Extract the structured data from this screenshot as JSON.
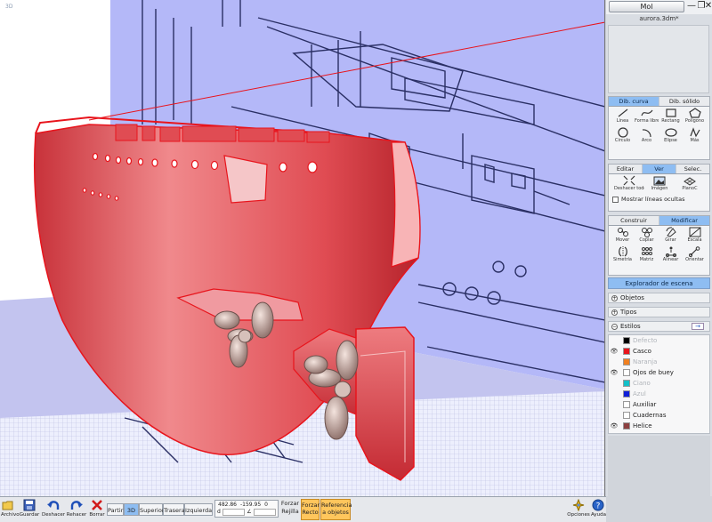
{
  "window": {
    "viewport_label": "3D",
    "mol_button": "Mol",
    "filename": "aurora.3dm*",
    "minimize": "—",
    "restore": "❐",
    "close": "✕"
  },
  "panels": {
    "curve_tabs": [
      "Dib. curva",
      "Dib. sólido"
    ],
    "curve_tools": [
      "Línea",
      "Forma libre",
      "Rectang",
      "Polígono",
      "Círculo",
      "Arco",
      "Elipse",
      "Más"
    ],
    "view_tabs": [
      "Editar",
      "Ver",
      "Selec."
    ],
    "view_tools": [
      "Deshacer todo",
      "Imágen",
      "PlanoC"
    ],
    "hidden_lines_label": "Mostrar líneas ocultas",
    "transform_tabs": [
      "Construir",
      "Modificar"
    ],
    "transform_tools": [
      "Mover",
      "Copiar",
      "Girar",
      "Escala",
      "Simetría",
      "Matriz",
      "Alinear",
      "Orientar"
    ]
  },
  "explorer": {
    "title": "Explorador de escena",
    "sections": [
      "Objetos",
      "Tipos",
      "Estilos"
    ],
    "collapsed_symbol": "+",
    "expanded_symbol": "−",
    "eye_symbol": "👁",
    "styles_arrow": "→",
    "layers": [
      {
        "name": "Defecto",
        "color": "#000000",
        "visible": false,
        "dim": true
      },
      {
        "name": "Casco",
        "color": "#e8141c",
        "visible": true,
        "dim": false
      },
      {
        "name": "Naranja",
        "color": "#f08020",
        "visible": false,
        "dim": true
      },
      {
        "name": "Ojos de buey",
        "color": "#ffffff",
        "visible": true,
        "dim": false
      },
      {
        "name": "Ciano",
        "color": "#14c0c8",
        "visible": false,
        "dim": true
      },
      {
        "name": "Azul",
        "color": "#1020d8",
        "visible": false,
        "dim": true
      },
      {
        "name": "Auxiliar",
        "color": "#ffffff",
        "visible": false,
        "dim": false
      },
      {
        "name": "Cuadernas",
        "color": "#ffffff",
        "visible": false,
        "dim": false
      },
      {
        "name": "Helice",
        "color": "#8c4040",
        "visible": true,
        "dim": false
      }
    ]
  },
  "bottombar": {
    "file_buttons": [
      "Archivo",
      "Guardar",
      "Deshacer",
      "Rehacer",
      "Borrar"
    ],
    "views": [
      "Partir",
      "3D",
      "Superior",
      "Trasera",
      "Izquierda"
    ],
    "active_view": "3D",
    "coords": {
      "x": "482.86",
      "y": "-159.95",
      "z": "0",
      "d_label": "d",
      "angle_symbol": "∠"
    },
    "grid_snap": [
      "Forzar",
      "Rejilla"
    ],
    "ortho": [
      "Forzar",
      "Recto"
    ],
    "object_snap": [
      "Referencia",
      "a objetos"
    ],
    "right_buttons": [
      "Opciones",
      "Ayuda"
    ]
  },
  "colors": {
    "accent": "#8ebdf2",
    "hull": "#e8141c",
    "blueprint": "#b4b8f8",
    "snap": "#ffc65c"
  }
}
